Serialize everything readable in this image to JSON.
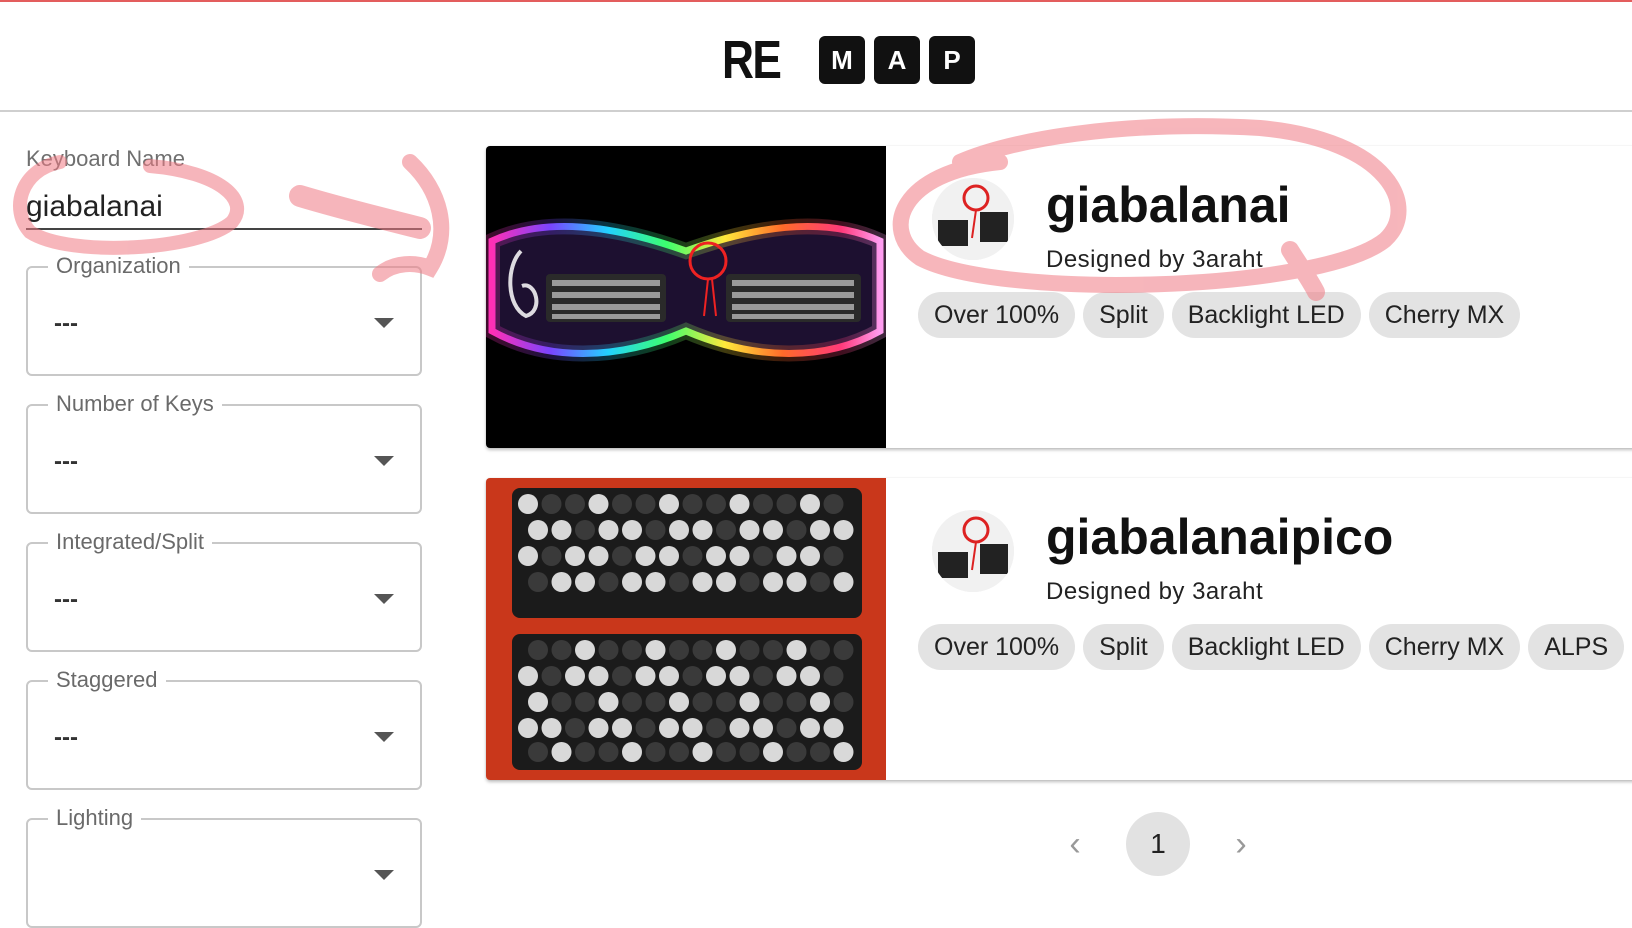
{
  "brand": {
    "logo_plain": "RE",
    "logo_boxed": [
      "M",
      "A",
      "P"
    ]
  },
  "filters": {
    "keyboard_name": {
      "label": "Keyboard Name",
      "value": "giabalanai"
    },
    "selects": [
      {
        "label": "Organization",
        "value": "---"
      },
      {
        "label": "Number of Keys",
        "value": "---"
      },
      {
        "label": "Integrated/Split",
        "value": "---"
      },
      {
        "label": "Staggered",
        "value": "---"
      },
      {
        "label": "Lighting",
        "value": ""
      }
    ]
  },
  "results": [
    {
      "name": "giabalanai",
      "designer": "Designed by 3araht",
      "tags": [
        "Over 100%",
        "Split",
        "Backlight LED",
        "Cherry MX"
      ]
    },
    {
      "name": "giabalanaipico",
      "designer": "Designed by 3araht",
      "tags": [
        "Over 100%",
        "Split",
        "Backlight LED",
        "Cherry MX",
        "ALPS"
      ]
    }
  ],
  "pagination": {
    "current": "1",
    "prev_icon": "chevron-left-icon",
    "next_icon": "chevron-right-icon"
  },
  "colors": {
    "annotation": "#f07a84",
    "accent_line": "#e35d5d",
    "chip_bg": "#e3e3e3"
  }
}
